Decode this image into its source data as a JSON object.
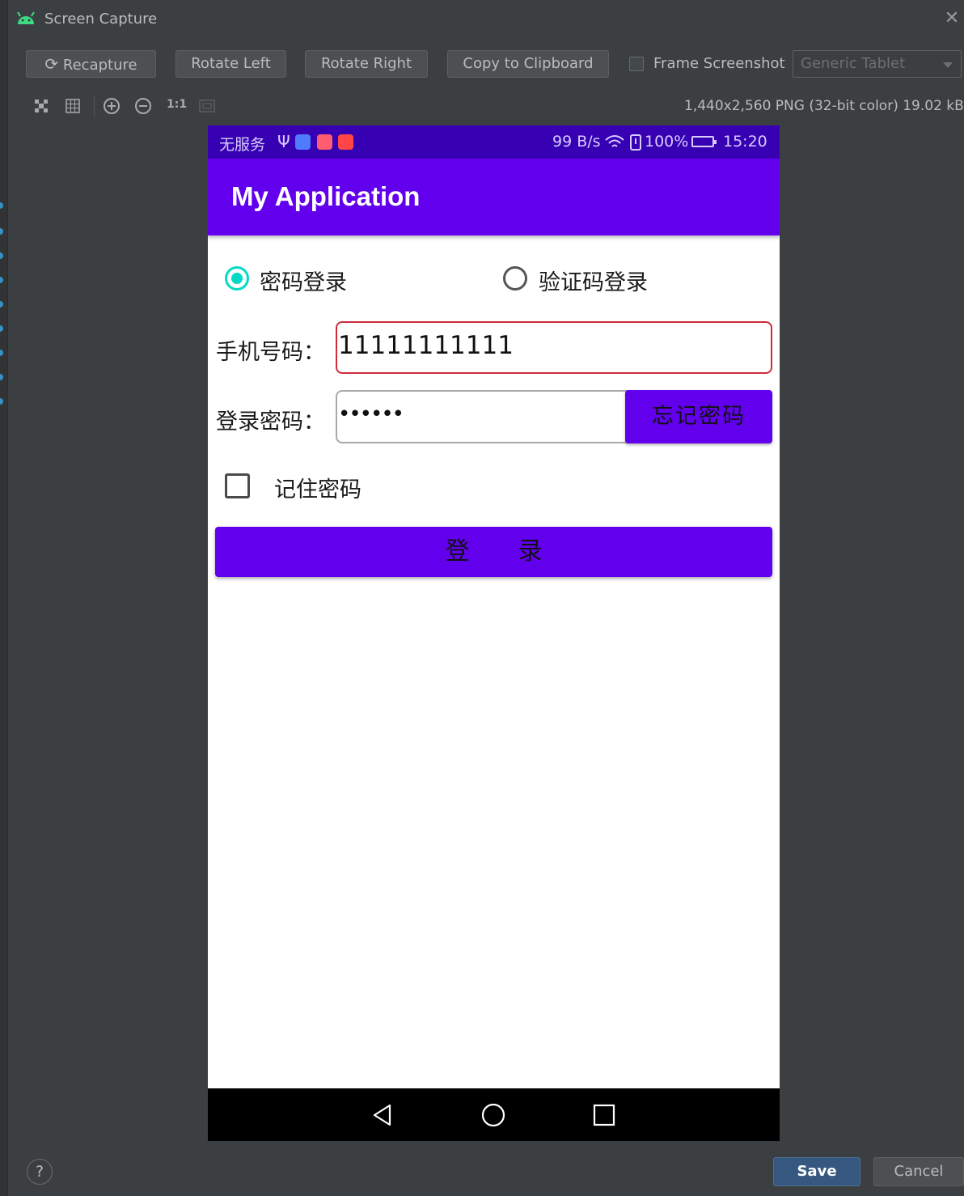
{
  "window": {
    "title": "Screen Capture",
    "close_icon": "close-icon"
  },
  "toolbar": {
    "recapture": "Recapture",
    "rotate_left": "Rotate Left",
    "rotate_right": "Rotate Right",
    "copy": "Copy to Clipboard",
    "frame_screenshot": "Frame Screenshot",
    "frame_screenshot_checked": false,
    "device": "Generic Tablet"
  },
  "view_tools": {
    "icons": [
      "fit-icon",
      "grid-icon",
      "zoom-in-icon",
      "zoom-out-icon",
      "actual-size-icon",
      "fit-window-icon"
    ],
    "actual_size_label": "1:1"
  },
  "image_info": "1,440x2,560 PNG (32-bit color) 19.02 kB",
  "device_screen": {
    "status_bar": {
      "carrier": "无服务",
      "speed": "99 B/s",
      "battery": "100%",
      "time": "15:20"
    },
    "app_title": "My Application",
    "login_mode": {
      "options": [
        "密码登录",
        "验证码登录"
      ],
      "selected": 0
    },
    "phone_label": "手机号码：",
    "phone_value": "11111111111",
    "password_label": "登录密码：",
    "password_value": "••••••",
    "forgot_button": "忘记密码",
    "remember_label": "记住密码",
    "remember_checked": false,
    "login_button": "登　　录",
    "colors": {
      "primary": "#6200ee",
      "primary_dark": "#3700b3",
      "radio_accent": "#03dac5",
      "error_border": "#cf2b3d"
    }
  },
  "footer": {
    "help": "?",
    "save": "Save",
    "cancel": "Cancel"
  }
}
